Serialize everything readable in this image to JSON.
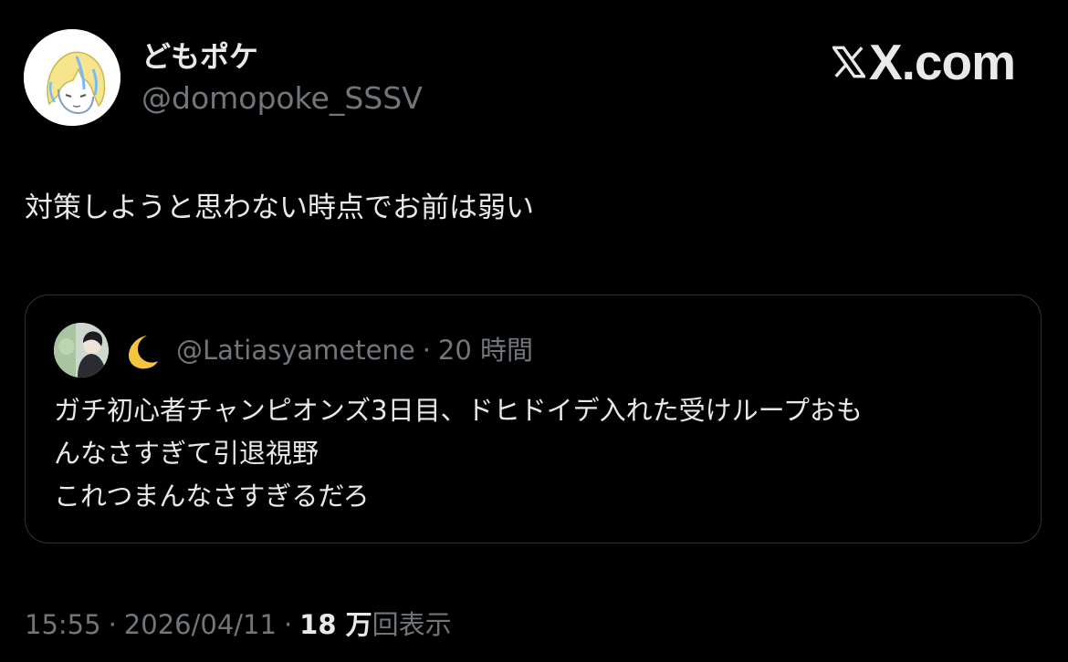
{
  "tweet": {
    "author": {
      "display_name": "どもポケ",
      "handle": "@domopoke_SSSV"
    },
    "brand": "X.com",
    "text": "対策しようと思わない時点でお前は弱い",
    "quote": {
      "name_icon": "crescent-moon-icon",
      "handle": "@Latiasyametene",
      "separator": "·",
      "time": "20 時間",
      "lines": [
        "ガチ初心者チャンピオンズ3日目、ドヒドイデ入れた受けループおも",
        "んなさすぎて引退視野",
        "これつまんなさすぎるだろ"
      ]
    },
    "footer": {
      "time": "15:55",
      "separator": "·",
      "date": "2026/04/11",
      "views_count": "18 万",
      "views_label": "回表示"
    }
  },
  "colors": {
    "background": "#000000",
    "text_primary": "#e7e9ea",
    "text_secondary": "#71767b",
    "border": "#2f3336",
    "moon": "#f5c542"
  }
}
